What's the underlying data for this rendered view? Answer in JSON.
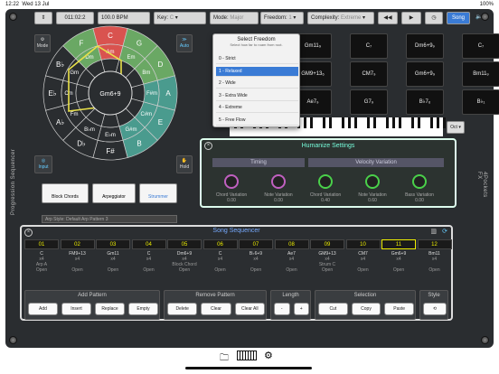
{
  "status": {
    "time": "12:22",
    "date": "Wed 13 Jul",
    "battery": "100%"
  },
  "topbar": {
    "position": "011:02:2",
    "bpm": "100.0 BPM",
    "key_label": "Key:",
    "key_value": "C",
    "mode_label": "Mode:",
    "mode_value": "Major",
    "freedom_label": "Freedom:",
    "freedom_value": "1",
    "complexity_label": "Complexity:",
    "complexity_value": "Extreme",
    "song_label": "Song"
  },
  "left": {
    "mode_label": "Mode",
    "auto_label": "Auto",
    "input_label": "Input",
    "hold_label": "Hold",
    "side_title": "Progression Sequencer",
    "circle_center": "Gm6+9",
    "arp_style_label": "Arp Style:",
    "arp_style_value": "Default Arp Pattern 3"
  },
  "circle": {
    "outer": [
      "C",
      "G",
      "D",
      "A",
      "E",
      "B",
      "F#",
      "D♭",
      "A♭",
      "E♭",
      "B♭",
      "F"
    ],
    "middle": [
      "Am",
      "Em",
      "Bm",
      "F#m",
      "C#m",
      "G#m",
      "E♭m",
      "B♭m",
      "Fm",
      "Cm",
      "Gm",
      "Dm"
    ],
    "numerals": [
      "IV",
      "I",
      "V",
      "ii",
      "vi",
      "iii",
      "vii°"
    ]
  },
  "modes": {
    "block_chords": "Block Chords",
    "arpeggiator": "Arpeggiator",
    "strummer": "Strummer"
  },
  "grid": {
    "cells": [
      "",
      "Gm11₉",
      "C₇",
      "Dm6+9₉",
      "C₇",
      "",
      "GM9+13₆",
      "CM7₉",
      "Gm6+9₉",
      "Bm11₉",
      "",
      "Ae7₉",
      "G7₉",
      "B♭7₆",
      "B♭₁"
    ],
    "oct_label": "Oct"
  },
  "right": {
    "side_title": "4Pockets FX"
  },
  "freedom_menu": {
    "title": "Select Freedom",
    "subtitle": "Select how far to roam from root.",
    "items": [
      "0 - Strict",
      "1 - Relaxed",
      "2 - Wide",
      "3 - Extra Wide",
      "4 - Extreme",
      "5 - Free Flow"
    ],
    "selected": 1
  },
  "humanize": {
    "title": "Humanize Settings",
    "timing": "Timing",
    "velocity": "Velocity Variation",
    "knobs": [
      {
        "label": "Chord Variation",
        "value": "0.00"
      },
      {
        "label": "Note Variation",
        "value": "0.00"
      },
      {
        "label": "Chord Variation",
        "value": "0.40"
      },
      {
        "label": "Note Variation",
        "value": "0.60"
      },
      {
        "label": "Bass Variation",
        "value": "0.00"
      }
    ]
  },
  "sequencer": {
    "title": "Song Sequencer",
    "slots": [
      {
        "num": "01",
        "chord": "C",
        "rep": "x4",
        "extra": "Arp A",
        "state": "Open"
      },
      {
        "num": "02",
        "chord": "FM9+13",
        "rep": "x4",
        "extra": "",
        "state": "Open"
      },
      {
        "num": "03",
        "chord": "Gm11",
        "rep": "x4",
        "extra": "",
        "state": "Open"
      },
      {
        "num": "04",
        "chord": "C",
        "rep": "x4",
        "extra": "",
        "state": "Open"
      },
      {
        "num": "05",
        "chord": "Dm6+9",
        "rep": "x4",
        "extra": "Block Chord",
        "state": "Open"
      },
      {
        "num": "06",
        "chord": "C",
        "rep": "x4",
        "extra": "",
        "state": "Open"
      },
      {
        "num": "07",
        "chord": "B♭6+9",
        "rep": "x4",
        "extra": "",
        "state": "Open"
      },
      {
        "num": "08",
        "chord": "Ae7",
        "rep": "x4",
        "extra": "",
        "state": "Open"
      },
      {
        "num": "09",
        "chord": "GM9+13",
        "rep": "x4",
        "extra": "Strum C",
        "state": "Open"
      },
      {
        "num": "10",
        "chord": "CM7",
        "rep": "x4",
        "extra": "",
        "state": "Open"
      },
      {
        "num": "11",
        "chord": "Gm6+9",
        "rep": "x4",
        "extra": "",
        "state": "Open"
      },
      {
        "num": "12",
        "chord": "Bm11",
        "rep": "x4",
        "extra": "",
        "state": "Open"
      }
    ],
    "groups": [
      {
        "label": "Add Pattern",
        "buttons": [
          "Add",
          "Insert",
          "Replace",
          "Empty"
        ]
      },
      {
        "label": "Remove Pattern",
        "buttons": [
          "Delete",
          "Clear",
          "Clear All"
        ]
      },
      {
        "label": "Length",
        "buttons": [
          "-",
          "+"
        ]
      },
      {
        "label": "Selection",
        "buttons": [
          "Cut",
          "Copy",
          "Paste"
        ]
      },
      {
        "label": "Style",
        "buttons": [
          "⟲"
        ]
      }
    ]
  },
  "colors": {
    "accent": "#3a7bd5",
    "red": "#d9534f",
    "green": "#6aa864",
    "teal": "#4a9b8e",
    "yellow": "#e8e04a"
  }
}
